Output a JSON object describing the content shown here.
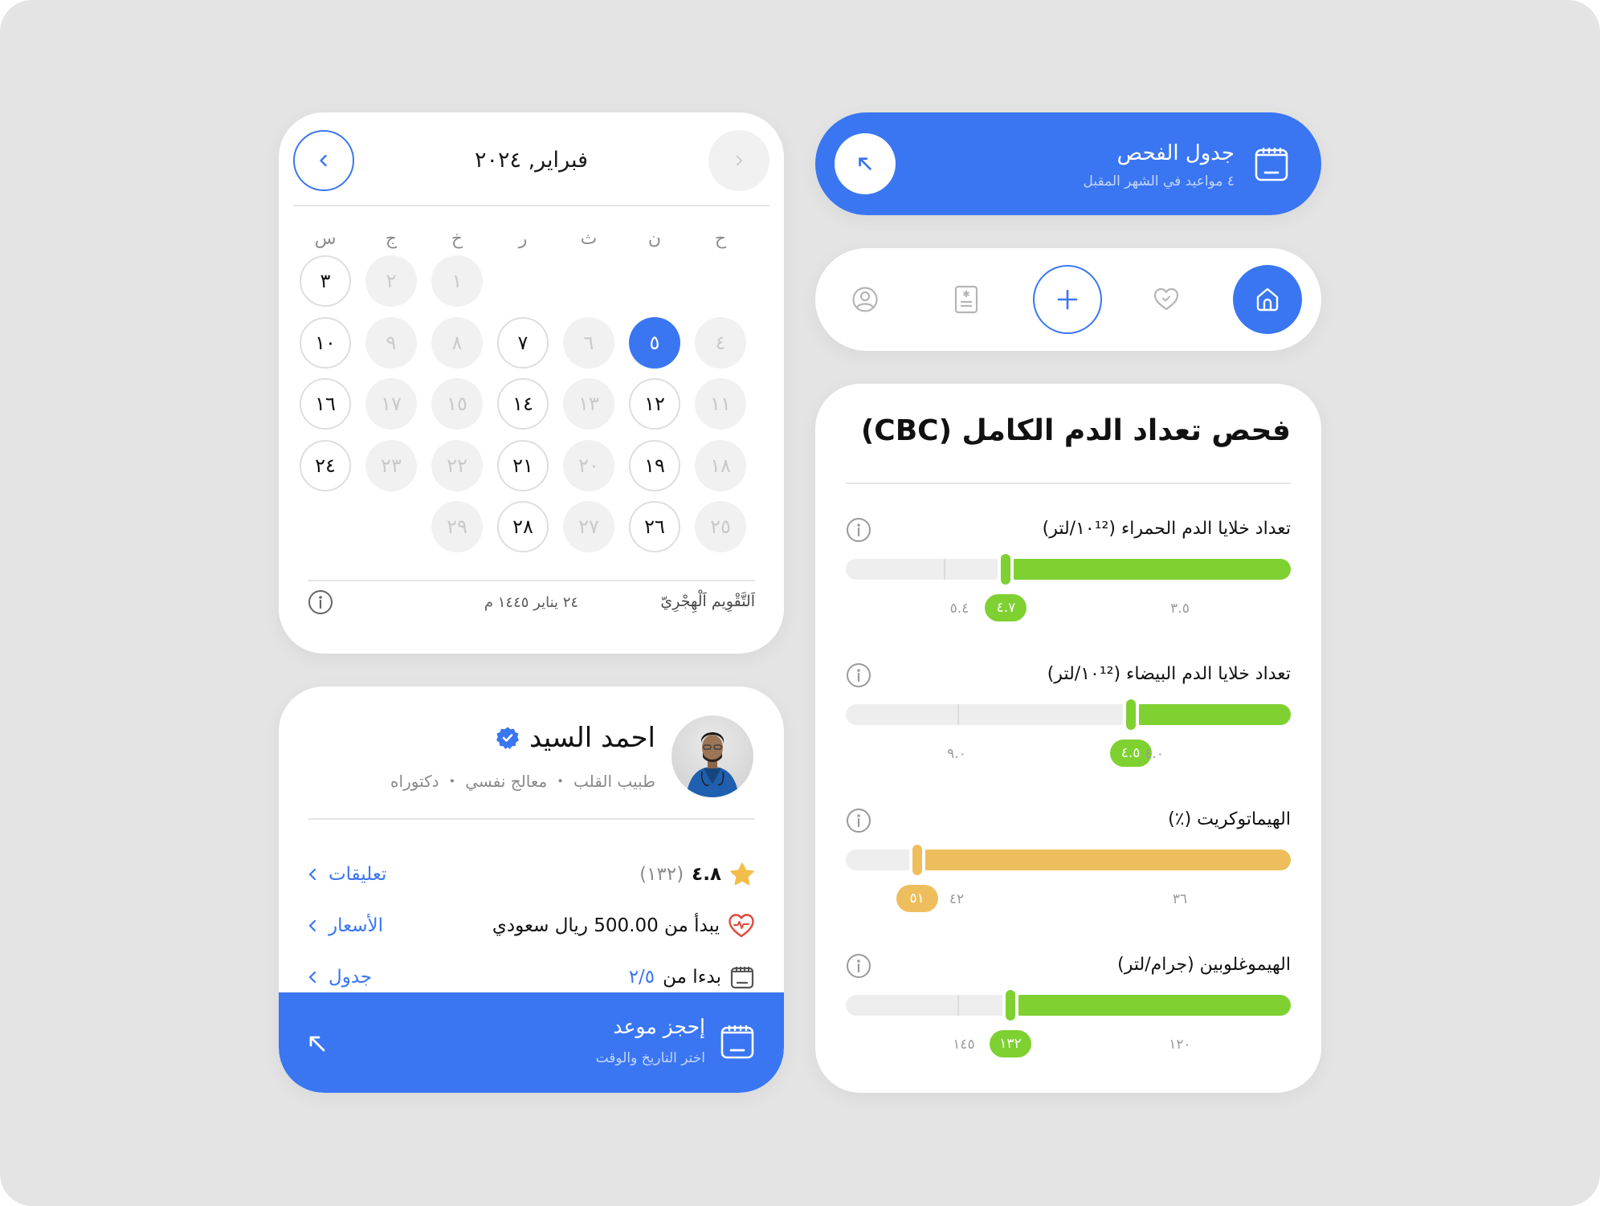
{
  "colors": {
    "primary": "#3a76f2",
    "green": "#7ed131",
    "amber": "#efbe5c",
    "muted_bg": "#f1f1f1",
    "frame_bg": "#e4e4e4"
  },
  "calendar": {
    "title": "فبراير, ٢٠٢٤",
    "prev_icon": "chevron-left-icon",
    "next_icon": "chevron-right-icon",
    "weekdays": [
      "ح",
      "ن",
      "ث",
      "ر",
      "خ",
      "ج",
      "س"
    ],
    "weeks": [
      [
        null,
        null,
        null,
        null,
        {
          "label": "١",
          "state": "muted"
        },
        {
          "label": "٢",
          "state": "muted"
        },
        {
          "label": "٣",
          "state": "active"
        }
      ],
      [
        {
          "label": "٤",
          "state": "muted"
        },
        {
          "label": "٥",
          "state": "selected"
        },
        {
          "label": "٦",
          "state": "muted"
        },
        {
          "label": "٧",
          "state": "active"
        },
        {
          "label": "٨",
          "state": "muted"
        },
        {
          "label": "٩",
          "state": "muted"
        },
        {
          "label": "١٠",
          "state": "active"
        }
      ],
      [
        {
          "label": "١١",
          "state": "muted"
        },
        {
          "label": "١٢",
          "state": "active"
        },
        {
          "label": "١٣",
          "state": "muted"
        },
        {
          "label": "١٤",
          "state": "active"
        },
        {
          "label": "١٥",
          "state": "muted"
        },
        {
          "label": "١٧",
          "state": "muted"
        },
        {
          "label": "١٦",
          "state": "active"
        }
      ],
      [
        {
          "label": "١٨",
          "state": "muted"
        },
        {
          "label": "١٩",
          "state": "active"
        },
        {
          "label": "٢٠",
          "state": "muted"
        },
        {
          "label": "٢١",
          "state": "active"
        },
        {
          "label": "٢٢",
          "state": "muted"
        },
        {
          "label": "٢٣",
          "state": "muted"
        },
        {
          "label": "٢٤",
          "state": "active"
        }
      ],
      [
        {
          "label": "٢٥",
          "state": "muted"
        },
        {
          "label": "٢٦",
          "state": "active"
        },
        {
          "label": "٢٧",
          "state": "muted"
        },
        {
          "label": "٢٨",
          "state": "active"
        },
        {
          "label": "٢٩",
          "state": "muted"
        },
        null,
        null
      ]
    ],
    "footer": {
      "calendar_type": "اَلتَّقْوِيم اَلْهِجْرِيّ",
      "converted_date": "٢٤ يناير ١٤٤٥ م",
      "info_icon": "info-icon"
    }
  },
  "profile": {
    "name": "احمد السيد",
    "verified": true,
    "subtitle": "طبيب القلب ・ معالج نفسي ・ دكتوراه",
    "rows": [
      {
        "icon": "star-icon",
        "value": "٤.٨",
        "extra": "(١٣٢)",
        "link": "تعليقات"
      },
      {
        "icon": "heart-pulse-icon",
        "value": "يبدأ من 500.00 ريال سعودي",
        "link": "الأسعار"
      },
      {
        "icon": "calendar-icon",
        "value_prefix": "بدءا من",
        "value_highlight": "٢/٥",
        "link": "جدول"
      }
    ],
    "book": {
      "title": "إحجز موعد",
      "subtitle": "اختر التاريخ والوقت"
    }
  },
  "exam_banner": {
    "title": "جدول الفحص",
    "subtitle": "٤ مواعيد في الشهر المقبل"
  },
  "navbar": {
    "items": [
      {
        "name": "home",
        "icon": "home-icon",
        "active": true
      },
      {
        "name": "health",
        "icon": "heart-check-icon",
        "active": false
      },
      {
        "name": "add",
        "icon": "plus-icon",
        "active": false
      },
      {
        "name": "records",
        "icon": "medical-record-icon",
        "active": false
      },
      {
        "name": "profile",
        "icon": "user-circle-icon",
        "active": false
      }
    ]
  },
  "cbc": {
    "title": "فحص تعداد الدم الكامل (CBC)",
    "metrics": [
      {
        "label": "تعداد خلايا الدم الحمراء (١٠¹²/لتر)",
        "value": 4.7,
        "value_label": "٤.٧",
        "range_low": 3.5,
        "range_low_label": "٣.٥",
        "range_high": 5.4,
        "range_high_label": "٥.٤",
        "status": "normal",
        "fill_fraction": 0.64,
        "tick_fraction": 0.78
      },
      {
        "label": "تعداد خلايا الدم البيضاء (١٠¹²/لتر)",
        "value": 4.5,
        "value_label": "٤.٥",
        "range_low": 4.0,
        "range_low_label": "٤.٠",
        "range_high": 9.0,
        "range_high_label": "٩.٠",
        "status": "normal",
        "fill_fraction": 0.36,
        "tick_fraction": 0.75
      },
      {
        "label": "الهيماتوكريت (٪)",
        "value": 51,
        "value_label": "٥١",
        "range_low": 36,
        "range_low_label": "٣٦",
        "range_high": 42,
        "range_high_label": "٤٢",
        "status": "high",
        "fill_fraction": 0.84,
        "tick_fraction": null
      },
      {
        "label": "الهيموغلوبين (جرام/لتر)",
        "value": 132,
        "value_label": "١٣٢",
        "range_low": 120,
        "range_low_label": "١٢٠",
        "range_high": 145,
        "range_high_label": "١٤٥",
        "status": "normal",
        "fill_fraction": 0.63,
        "tick_fraction": 0.75
      }
    ]
  }
}
